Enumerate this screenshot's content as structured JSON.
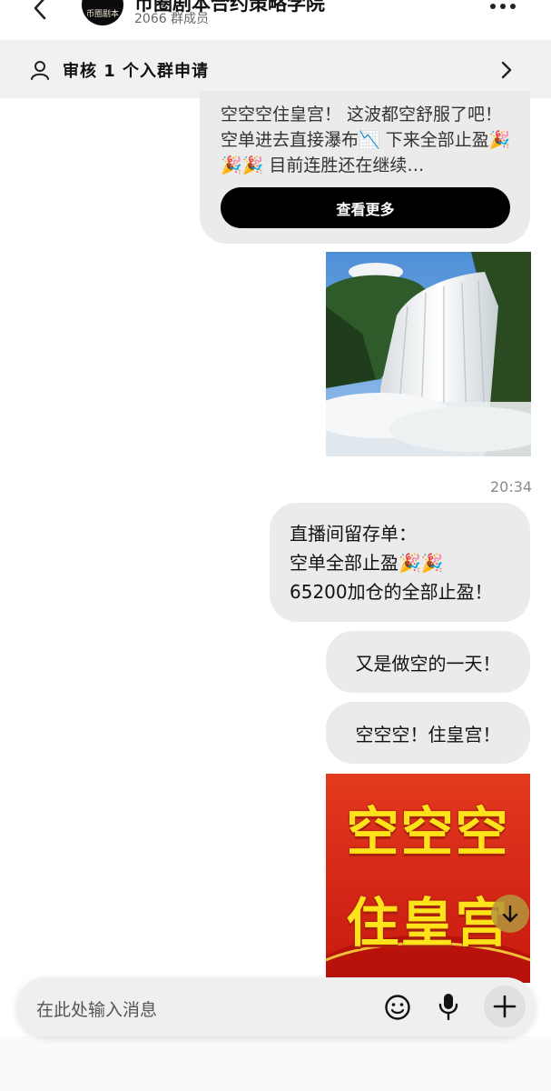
{
  "header": {
    "group_name": "币圈剧本合约策略学院",
    "member_count": "2066 群成员",
    "avatar_text": "币圈剧本"
  },
  "banner": {
    "text": "审核 1 个入群申请"
  },
  "messages": {
    "card_text": "空空空住皇宫！ 这波都空舒服了吧！ 空单进去直接瀑布📉 下来全部止盈🎉🎉🎉 目前连胜还在继续…",
    "view_more": "查看更多",
    "time": "20:34",
    "bubble1_line1": "直播间留存单：",
    "bubble1_line2": "空单全部止盈🎉🎉",
    "bubble1_line3": "65200加仓的全部止盈！",
    "bubble2": "又是做空的一天！",
    "bubble3": "空空空！住皇宫！",
    "poster_line1": "空空空",
    "poster_line2": "住皇宫"
  },
  "input": {
    "placeholder": "在此处输入消息"
  },
  "icons": {
    "back": "back-arrow-icon",
    "more": "more-dots-icon",
    "person": "person-icon",
    "chevron": "chevron-right-icon",
    "scroll": "arrow-down-icon",
    "emoji": "emoji-icon",
    "mic": "microphone-icon",
    "plus": "plus-icon"
  },
  "colors": {
    "bubble": "#ebebeb",
    "button": "#000000",
    "poster_bg": "#d5231a",
    "poster_text": "#ffe31a"
  }
}
